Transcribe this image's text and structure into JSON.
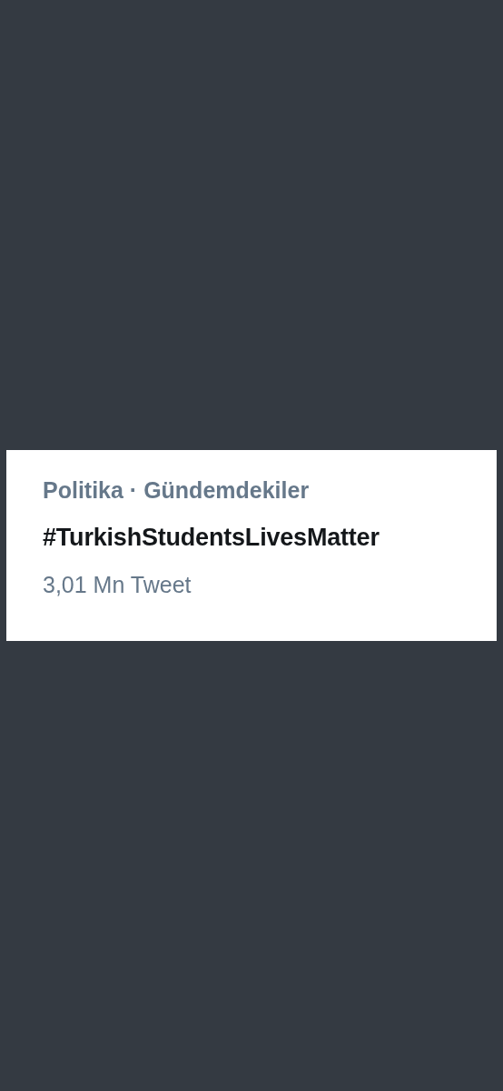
{
  "trend": {
    "context": "Politika · Gündemdekiler",
    "hashtag": "#TurkishStudentsLivesMatter",
    "count": "3,01 Mn Tweet"
  }
}
